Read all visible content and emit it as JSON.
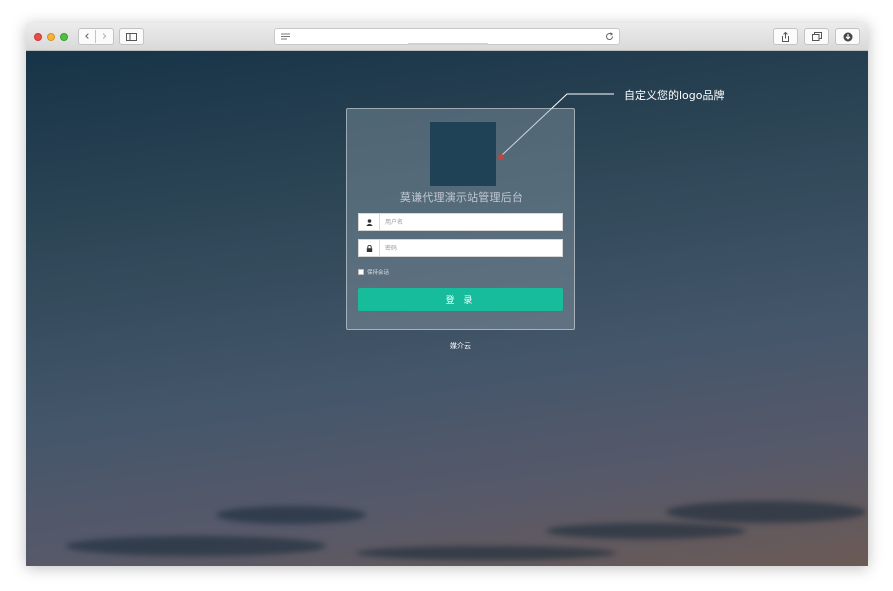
{
  "browser": {
    "back_label": "‹",
    "forward_label": "›",
    "address_value": ""
  },
  "login": {
    "site_title": "莫谦代理演示站管理后台",
    "username_placeholder": "用户名",
    "password_placeholder": "密码",
    "remember_label": "保持会话",
    "submit_label": "登 录"
  },
  "footer": {
    "brand": "媒介云"
  },
  "annotation": {
    "text": "自定义您的logo品牌"
  },
  "colors": {
    "accent": "#17bc9c",
    "logo_placeholder": "#1f4257",
    "annotation_dot": "#c0463a"
  },
  "icons": {
    "username": "user-icon",
    "password": "lock-icon",
    "reader": "reader-icon",
    "reload": "reload-icon",
    "sidebar": "sidebar-icon",
    "share": "share-icon",
    "tabs": "tabs-icon",
    "download": "download-icon"
  }
}
